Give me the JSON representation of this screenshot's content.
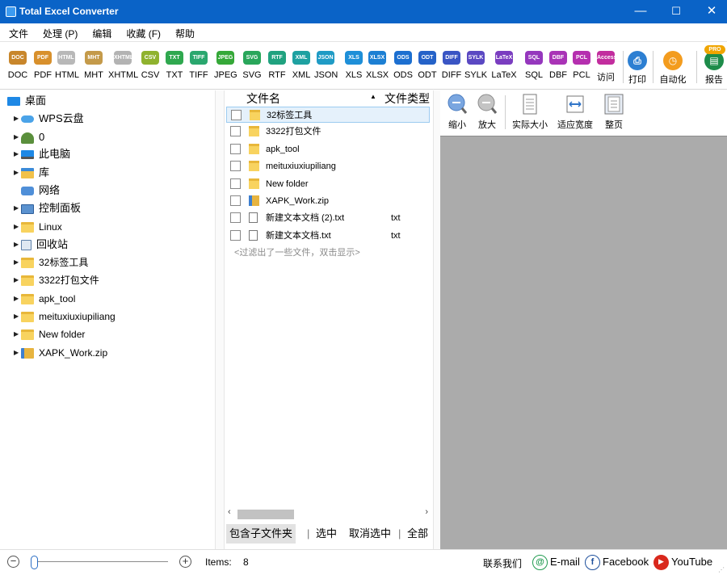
{
  "app": {
    "title": "Total Excel Converter",
    "controls": {
      "minimize": "—",
      "maximize": "☐",
      "close": "✕"
    }
  },
  "menu": [
    "文件",
    "处理 (P)",
    "编辑",
    "收藏 (F)",
    "帮助"
  ],
  "toolbar": {
    "formats": [
      {
        "icon": "DOC",
        "label": "DOC",
        "color": "#c8862b"
      },
      {
        "icon": "PDF",
        "label": "PDF",
        "color": "#d8902c"
      },
      {
        "icon": "HTML",
        "label": "HTML",
        "color": "#b8b8b8"
      },
      {
        "icon": "MHT",
        "label": "MHT",
        "color": "#c49a4a"
      },
      {
        "icon": "XHTML",
        "label": "XHTML",
        "color": "#b3b3b3"
      },
      {
        "icon": "CSV",
        "label": "CSV",
        "color": "#8fb22e"
      },
      {
        "icon": "TXT",
        "label": "TXT",
        "color": "#2fa84f"
      },
      {
        "icon": "TIFF",
        "label": "TIFF",
        "color": "#2aa76e"
      },
      {
        "icon": "JPEG",
        "label": "JPEG",
        "color": "#35a838"
      },
      {
        "icon": "SVG",
        "label": "SVG",
        "color": "#29a65a"
      },
      {
        "icon": "RTF",
        "label": "RTF",
        "color": "#20a27f"
      },
      {
        "icon": "XML",
        "label": "XML",
        "color": "#1ea1a1"
      },
      {
        "icon": "JSON",
        "label": "JSON",
        "color": "#1f9bc5"
      },
      {
        "icon": "XLS",
        "label": "XLS",
        "color": "#1e8fd8"
      },
      {
        "icon": "XLSX",
        "label": "XLSX",
        "color": "#1c7fd3"
      },
      {
        "icon": "ODS",
        "label": "ODS",
        "color": "#1c6fd0"
      },
      {
        "icon": "ODT",
        "label": "ODT",
        "color": "#2562c8"
      },
      {
        "icon": "DIFF",
        "label": "DIFF",
        "color": "#3a55c4"
      },
      {
        "icon": "SYLK",
        "label": "SYLK",
        "color": "#5a48c2"
      },
      {
        "icon": "LaTeX",
        "label": "LaTeX",
        "color": "#7a3dc0"
      },
      {
        "icon": "SQL",
        "label": "SQL",
        "color": "#9537bd"
      },
      {
        "icon": "DBF",
        "label": "DBF",
        "color": "#a933b6"
      },
      {
        "icon": "PCL",
        "label": "PCL",
        "color": "#b52faf"
      },
      {
        "icon": "Access",
        "label": "访问",
        "color": "#c22d9e"
      }
    ],
    "print": "打印",
    "automation": "自动化",
    "report": "报告",
    "pro_badge": "PRO"
  },
  "tree": [
    {
      "label": "桌面",
      "icon": "desktop"
    },
    {
      "label": "WPS云盘",
      "icon": "cloud"
    },
    {
      "label": "0",
      "icon": "user"
    },
    {
      "label": "此电脑",
      "icon": "pc"
    },
    {
      "label": "库",
      "icon": "library"
    },
    {
      "label": "网络",
      "icon": "network"
    },
    {
      "label": "控制面板",
      "icon": "control-panel"
    },
    {
      "label": "Linux",
      "icon": "folder"
    },
    {
      "label": "回收站",
      "icon": "recycle-bin"
    },
    {
      "label": "32标签工具",
      "icon": "folder"
    },
    {
      "label": "3322打包文件",
      "icon": "folder"
    },
    {
      "label": "apk_tool",
      "icon": "folder"
    },
    {
      "label": "meituxiuxiupiliang",
      "icon": "folder"
    },
    {
      "label": "New folder",
      "icon": "folder"
    },
    {
      "label": "XAPK_Work.zip",
      "icon": "zip"
    }
  ],
  "files": {
    "col_name": "文件名",
    "col_type": "文件类型",
    "rows": [
      {
        "name": "32标签工具",
        "type": "",
        "icon": "folder"
      },
      {
        "name": "3322打包文件",
        "type": "",
        "icon": "folder"
      },
      {
        "name": "apk_tool",
        "type": "",
        "icon": "folder"
      },
      {
        "name": "meituxiuxiupiliang",
        "type": "",
        "icon": "folder"
      },
      {
        "name": "New folder",
        "type": "",
        "icon": "folder"
      },
      {
        "name": "XAPK_Work.zip",
        "type": "",
        "icon": "zip"
      },
      {
        "name": "新建文本文档 (2).txt",
        "type": "txt",
        "icon": "text-file"
      },
      {
        "name": "新建文本文档.txt",
        "type": "txt",
        "icon": "text-file"
      }
    ],
    "filtered_note": "<过滤出了一些文件，双击显示>",
    "buttons": {
      "include_subfolders": "包含子文件夹",
      "select": "选中",
      "deselect": "取消选中",
      "all": "全部"
    }
  },
  "preview": {
    "zoom_out": "缩小",
    "zoom_in": "放大",
    "actual_size": "实际大小",
    "fit_width": "适应宽度",
    "whole_page": "整页"
  },
  "status": {
    "items_label": "Items:",
    "items_count": "8",
    "zoom_level": 0,
    "contact": "联系我们",
    "email": "E-mail",
    "facebook": "Facebook",
    "youtube": "YouTube"
  }
}
